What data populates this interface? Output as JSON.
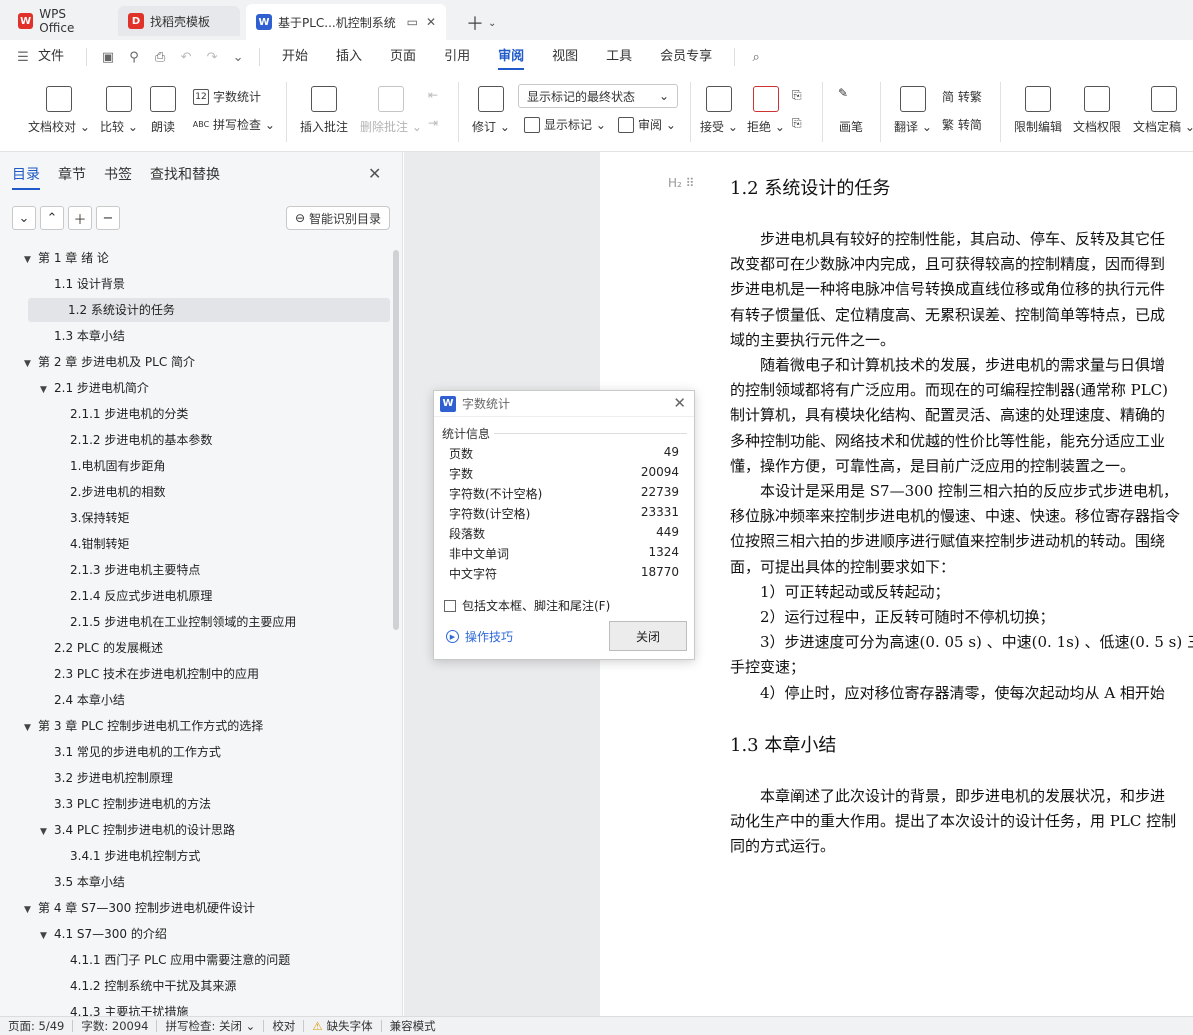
{
  "tabs": {
    "wps": "WPS Office",
    "template": "找稻壳模板",
    "document": "基于PLC...机控制系统"
  },
  "menu": {
    "file": "文件",
    "items": [
      "开始",
      "插入",
      "页面",
      "引用",
      "审阅",
      "视图",
      "工具",
      "会员专享"
    ],
    "active": "审阅"
  },
  "ribbon": {
    "doc_check": "文档校对",
    "compare": "比较",
    "read_aloud": "朗读",
    "word_count": "字数统计",
    "spell_check": "拼写检查",
    "insert_comment": "插入批注",
    "delete_comment": "删除批注",
    "revise": "修订",
    "markup_state": "显示标记的最终状态",
    "show_markup": "显示标记",
    "review": "审阅",
    "accept": "接受",
    "reject": "拒绝",
    "pen": "画笔",
    "translate": "翻译",
    "to_traditional": "简 转繁",
    "to_simplified": "繁 转简",
    "restrict_edit": "限制编辑",
    "doc_rights": "文档权限",
    "doc_finalize": "文档定稿"
  },
  "nav": {
    "tabs": [
      "目录",
      "章节",
      "书签",
      "查找和替换"
    ],
    "smart_toc": "智能识别目录",
    "toc": [
      {
        "text": "第 1 章  绪  论",
        "level": 0,
        "expanded": true
      },
      {
        "text": "1.1  设计背景",
        "level": 1
      },
      {
        "text": "1.2  系统设计的任务",
        "level": 1,
        "selected": true
      },
      {
        "text": "1.3  本章小结",
        "level": 1
      },
      {
        "text": "第 2 章  步进电机及 PLC 简介",
        "level": 0,
        "expanded": true
      },
      {
        "text": "2.1  步进电机简介",
        "level": 1,
        "expanded": true
      },
      {
        "text": "2.1.1  步进电机的分类",
        "level": 2
      },
      {
        "text": "2.1.2  步进电机的基本参数",
        "level": 2
      },
      {
        "text": "1.电机固有步距角",
        "level": 2
      },
      {
        "text": "2.步进电机的相数",
        "level": 2
      },
      {
        "text": "3.保持转矩",
        "level": 2
      },
      {
        "text": "4.钳制转矩",
        "level": 2
      },
      {
        "text": "2.1.3  步进电机主要特点",
        "level": 2
      },
      {
        "text": "2.1.4  反应式步进电机原理",
        "level": 2
      },
      {
        "text": "2.1.5  步进电机在工业控制领域的主要应用",
        "level": 2
      },
      {
        "text": "2.2 PLC 的发展概述",
        "level": 1
      },
      {
        "text": "2.3 PLC 技术在步进电机控制中的应用",
        "level": 1
      },
      {
        "text": "2.4  本章小结",
        "level": 1
      },
      {
        "text": "第 3 章  PLC 控制步进电机工作方式的选择",
        "level": 0,
        "expanded": true
      },
      {
        "text": "3.1  常见的步进电机的工作方式",
        "level": 1
      },
      {
        "text": "3.2  步进电机控制原理",
        "level": 1
      },
      {
        "text": "3.3 PLC 控制步进电机的方法",
        "level": 1
      },
      {
        "text": "3.4 PLC 控制步进电机的设计思路",
        "level": 1,
        "expanded": true
      },
      {
        "text": "3.4.1  步进电机控制方式",
        "level": 2
      },
      {
        "text": "3.5  本章小结",
        "level": 1
      },
      {
        "text": "第 4 章  S7—300 控制步进电机硬件设计",
        "level": 0,
        "expanded": true
      },
      {
        "text": "4.1 S7—300 的介绍",
        "level": 1,
        "expanded": true
      },
      {
        "text": "4.1.1  西门子  PLC  应用中需要注意的问题",
        "level": 2
      },
      {
        "text": "4.1.2  控制系统中干扰及其来源",
        "level": 2
      },
      {
        "text": "4.1.3  主要抗干扰措施",
        "level": 2
      }
    ]
  },
  "document": {
    "heading_marker": "H₂",
    "heading1": "1.2  系统设计的任务",
    "para1": [
      "　　步进电机具有较好的控制性能，其启动、停车、反转及其它任",
      "改变都可在少数脉冲内完成，且可获得较高的控制精度，因而得到",
      "步进电机是一种将电脉冲信号转换成直线位移或角位移的执行元件",
      "有转子惯量低、定位精度高、无累积误差、控制简单等特点，已成",
      "域的主要执行元件之一。",
      "　　随着微电子和计算机技术的发展，步进电机的需求量与日俱增",
      "的控制领域都将有广泛应用。而现在的可编程控制器(通常称 PLC)",
      "制计算机，具有模块化结构、配置灵活、高速的处理速度、精确的",
      "多种控制功能、网络技术和优越的性价比等性能，能充分适应工业",
      "懂，操作方便，可靠性高，是目前广泛应用的控制装置之一。",
      "　　本设计是采用是 S7—300 控制三相六拍的反应步式步进电机，",
      "移位脉冲频率来控制步进电机的慢速、中速、快速。移位寄存器指令",
      "位按照三相六拍的步进顺序进行赋值来控制步进动机的转动。围绕",
      "面，可提出具体的控制要求如下：",
      "　　1）可正转起动或反转起动；",
      "　　2）运行过程中，正反转可随时不停机切换；",
      "　　3）步进速度可分为高速(0. 05 s) 、中速(0. 1s) 、低速(0. 5 s) 三",
      "手控变速；",
      "　　4）停止时，应对移位寄存器清零，使每次起动均从 A  相开始"
    ],
    "heading2": "1.3  本章小结",
    "para2": [
      "　　本章阐述了此次设计的背景，即步进电机的发展状况，和步进",
      "动化生产中的重大作用。提出了本次设计的设计任务，用 PLC 控制",
      "同的方式运行。"
    ]
  },
  "dialog": {
    "title": "字数统计",
    "section": "统计信息",
    "stats": [
      {
        "label": "页数",
        "value": "49"
      },
      {
        "label": "字数",
        "value": "20094"
      },
      {
        "label": "字符数(不计空格)",
        "value": "22739"
      },
      {
        "label": "字符数(计空格)",
        "value": "23331"
      },
      {
        "label": "段落数",
        "value": "449"
      },
      {
        "label": "非中文单词",
        "value": "1324"
      },
      {
        "label": "中文字符",
        "value": "18770"
      }
    ],
    "checkbox": "包括文本框、脚注和尾注(F)",
    "tips": "操作技巧",
    "close": "关闭"
  },
  "status": {
    "page": "页面: 5/49",
    "words": "字数: 20094",
    "spell": "拼写检查: 关闭",
    "proof": "校对",
    "missing_font": "缺失字体",
    "compat": "兼容模式"
  },
  "colors": {
    "accent": "#1f5ac8",
    "wps_red": "#e0322a",
    "word_blue": "#2f5fd0"
  }
}
